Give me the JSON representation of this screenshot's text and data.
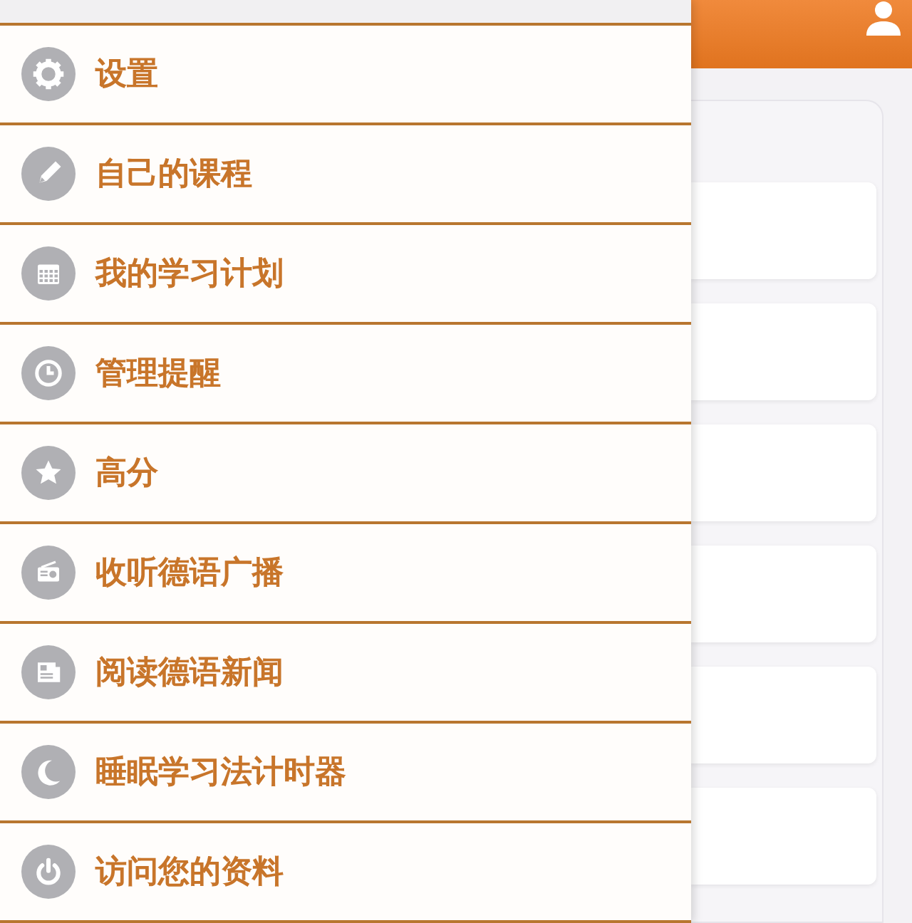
{
  "menu": {
    "items": [
      {
        "label": "设置"
      },
      {
        "label": "自己的课程"
      },
      {
        "label": "我的学习计划"
      },
      {
        "label": "管理提醒"
      },
      {
        "label": "高分"
      },
      {
        "label": "收听德语广播"
      },
      {
        "label": "阅读德语新闻"
      },
      {
        "label": "睡眠学习法计时器"
      },
      {
        "label": "访问您的资料"
      }
    ]
  }
}
